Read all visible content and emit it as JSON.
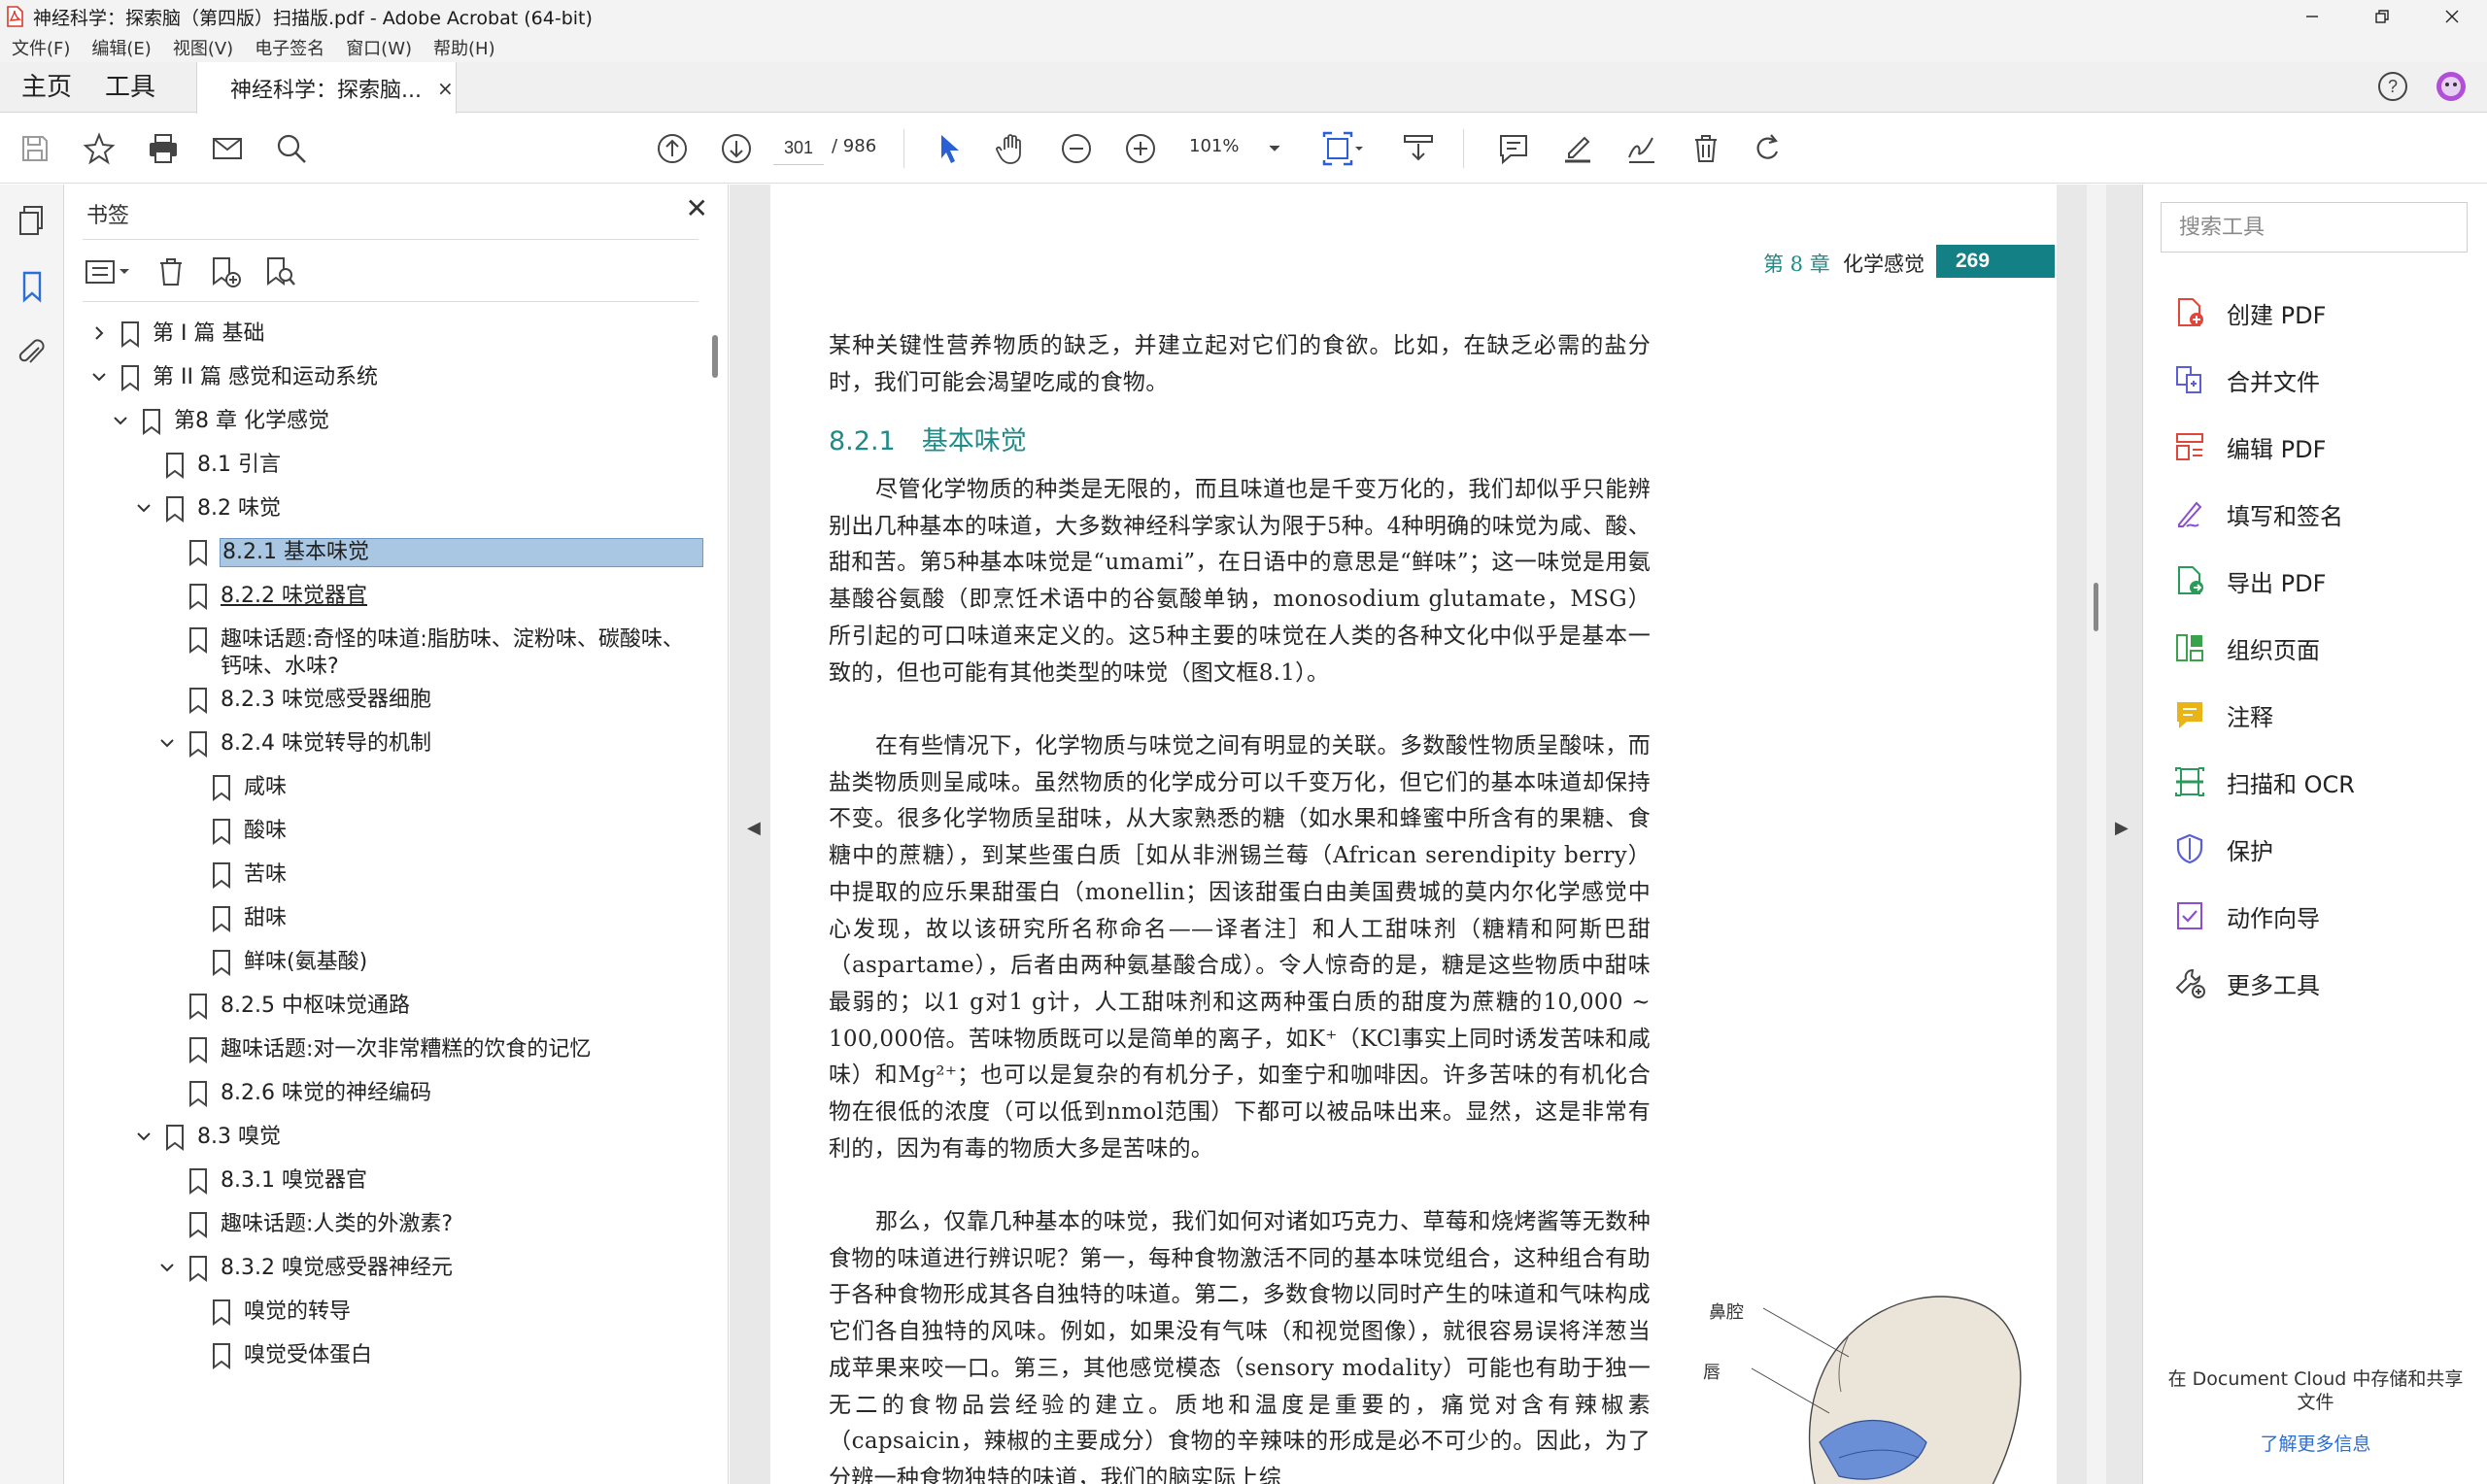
{
  "window": {
    "title": "神经科学：探索脑（第四版）扫描版.pdf - Adobe Acrobat (64-bit)"
  },
  "menu": [
    "文件(F)",
    "编辑(E)",
    "视图(V)",
    "电子签名",
    "窗口(W)",
    "帮助(H)"
  ],
  "tabs": {
    "home": "主页",
    "tools": "工具",
    "document": "神经科学：探索脑...",
    "close": "×"
  },
  "toolbar": {
    "current_page": "301",
    "total_pages": "/ 986",
    "zoom": "101%"
  },
  "bookmarks": {
    "title": "书签",
    "close": "✕",
    "items": [
      {
        "label": "第 I 篇 基础",
        "level": 0,
        "chevron": "right"
      },
      {
        "label": "第 II 篇 感觉和运动系统",
        "level": 0,
        "chevron": "down"
      },
      {
        "label": "第8 章 化学感觉",
        "level": 1,
        "chevron": "down"
      },
      {
        "label": "8.1 引言",
        "level": 2,
        "chevron": ""
      },
      {
        "label": "8.2 味觉",
        "level": 2,
        "chevron": "down"
      },
      {
        "label": "8.2.1 基本味觉",
        "level": 3,
        "chevron": "",
        "selected": true
      },
      {
        "label": "8.2.2 味觉器官",
        "level": 3,
        "chevron": "",
        "link": true
      },
      {
        "label": "趣味话题:奇怪的味道:脂肪味、淀粉味、碳酸味、钙味、水味?",
        "level": 3,
        "chevron": "",
        "wrap": true
      },
      {
        "label": "8.2.3 味觉感受器细胞",
        "level": 3,
        "chevron": ""
      },
      {
        "label": "8.2.4 味觉转导的机制",
        "level": 3,
        "chevron": "down"
      },
      {
        "label": "咸味",
        "level": 4,
        "chevron": ""
      },
      {
        "label": "酸味",
        "level": 4,
        "chevron": ""
      },
      {
        "label": "苦味",
        "level": 4,
        "chevron": ""
      },
      {
        "label": "甜味",
        "level": 4,
        "chevron": ""
      },
      {
        "label": "鲜味(氨基酸)",
        "level": 4,
        "chevron": ""
      },
      {
        "label": "8.2.5 中枢味觉通路",
        "level": 3,
        "chevron": ""
      },
      {
        "label": "趣味话题:对一次非常糟糕的饮食的记忆",
        "level": 3,
        "chevron": ""
      },
      {
        "label": "8.2.6 味觉的神经编码",
        "level": 3,
        "chevron": ""
      },
      {
        "label": "8.3 嗅觉",
        "level": 2,
        "chevron": "down"
      },
      {
        "label": "8.3.1 嗅觉器官",
        "level": 3,
        "chevron": ""
      },
      {
        "label": "趣味话题:人类的外激素?",
        "level": 3,
        "chevron": ""
      },
      {
        "label": "8.3.2 嗅觉感受器神经元",
        "level": 3,
        "chevron": "down"
      },
      {
        "label": "嗅觉的转导",
        "level": 4,
        "chevron": ""
      },
      {
        "label": "嗅觉受体蛋白",
        "level": 4,
        "chevron": ""
      }
    ]
  },
  "document": {
    "running_head_chapter": "第 8 章",
    "running_head_title": "化学感觉",
    "page_number": "269",
    "para1": "某种关键性营养物质的缺乏，并建立起对它们的食欲。比如，在缺乏必需的盐分时，我们可能会渴望吃咸的食物。",
    "section": "8.2.1　基本味觉",
    "para2": "尽管化学物质的种类是无限的，而且味道也是千变万化的，我们却似乎只能辨别出几种基本的味道，大多数神经科学家认为限于5种。4种明确的味觉为咸、酸、甜和苦。第5种基本味觉是“umami”，在日语中的意思是“鲜味”；这一味觉是用氨基酸谷氨酸（即烹饪术语中的谷氨酸单钠，monosodium glutamate，MSG）所引起的可口味道来定义的。这5种主要的味觉在人类的各种文化中似乎是基本一致的，但也可能有其他类型的味觉（图文框8.1）。",
    "para3": "在有些情况下，化学物质与味觉之间有明显的关联。多数酸性物质呈酸味，而盐类物质则呈咸味。虽然物质的化学成分可以千变万化，但它们的基本味道却保持不变。很多化学物质呈甜味，从大家熟悉的糖（如水果和蜂蜜中所含有的果糖、食糖中的蔗糖），到某些蛋白质［如从非洲锡兰莓（African serendipity berry）中提取的应乐果甜蛋白（monellin；因该甜蛋白由美国费城的莫内尔化学感觉中心发现，故以该研究所名称命名——译者注］和人工甜味剂（糖精和阿斯巴甜（aspartame），后者由两种氨基酸合成）。令人惊奇的是，糖是这些物质中甜味最弱的；以1 g对1 g计，人工甜味剂和这两种蛋白质的甜度为蔗糖的10,000 ~ 100,000倍。苦味物质既可以是简单的离子，如K⁺（KCl事实上同时诱发苦味和咸味）和Mg²⁺；也可以是复杂的有机分子，如奎宁和咖啡因。许多苦味的有机化合物在很低的浓度（可以低到nmol范围）下都可以被品味出来。显然，这是非常有利的，因为有毒的物质大多是苦味的。",
    "para4": "那么，仅靠几种基本的味觉，我们如何对诸如巧克力、草莓和烧烤酱等无数种食物的味道进行辨识呢？第一，每种食物激活不同的基本味觉组合，这种组合有助于各种食物形成其各自独特的味道。第二，多数食物以同时产生的味道和气味构成它们各自独特的风味。例如，如果没有气味（和视觉图像），就很容易误将洋葱当成苹果来咬一口。第三，其他感觉模态（sensory modality）可能也有助于独一无二的食物品尝经验的建立。质地和温度是重要的，痛觉对含有辣椒素（capsaicin，辣椒的主要成分）食物的辛辣味的形成是必不可少的。因此，为了分辨一种食物独特的味道，我们的脑实际上综",
    "figure_label_nose": "鼻腔",
    "figure_label_lips": "唇"
  },
  "tools_panel": {
    "search_placeholder": "搜索工具",
    "items": [
      {
        "label": "创建 PDF",
        "icon": "create-pdf-icon",
        "color": "#e0463a"
      },
      {
        "label": "合并文件",
        "icon": "combine-files-icon",
        "color": "#5b5fd6"
      },
      {
        "label": "编辑 PDF",
        "icon": "edit-pdf-icon",
        "color": "#e0463a"
      },
      {
        "label": "填写和签名",
        "icon": "fill-sign-icon",
        "color": "#8a4fd0"
      },
      {
        "label": "导出 PDF",
        "icon": "export-pdf-icon",
        "color": "#2a9a5b"
      },
      {
        "label": "组织页面",
        "icon": "organize-pages-icon",
        "color": "#3aa24a"
      },
      {
        "label": "注释",
        "icon": "comment-icon",
        "color": "#e8b418"
      },
      {
        "label": "扫描和 OCR",
        "icon": "scan-ocr-icon",
        "color": "#2a9a5b"
      },
      {
        "label": "保护",
        "icon": "protect-icon",
        "color": "#5b5fd6"
      },
      {
        "label": "动作向导",
        "icon": "action-wizard-icon",
        "color": "#8a4fd0"
      },
      {
        "label": "更多工具",
        "icon": "more-tools-icon",
        "color": "#444444"
      }
    ],
    "cloud_text": "在 Document Cloud 中存储和共享文件",
    "cloud_link": "了解更多信息"
  }
}
